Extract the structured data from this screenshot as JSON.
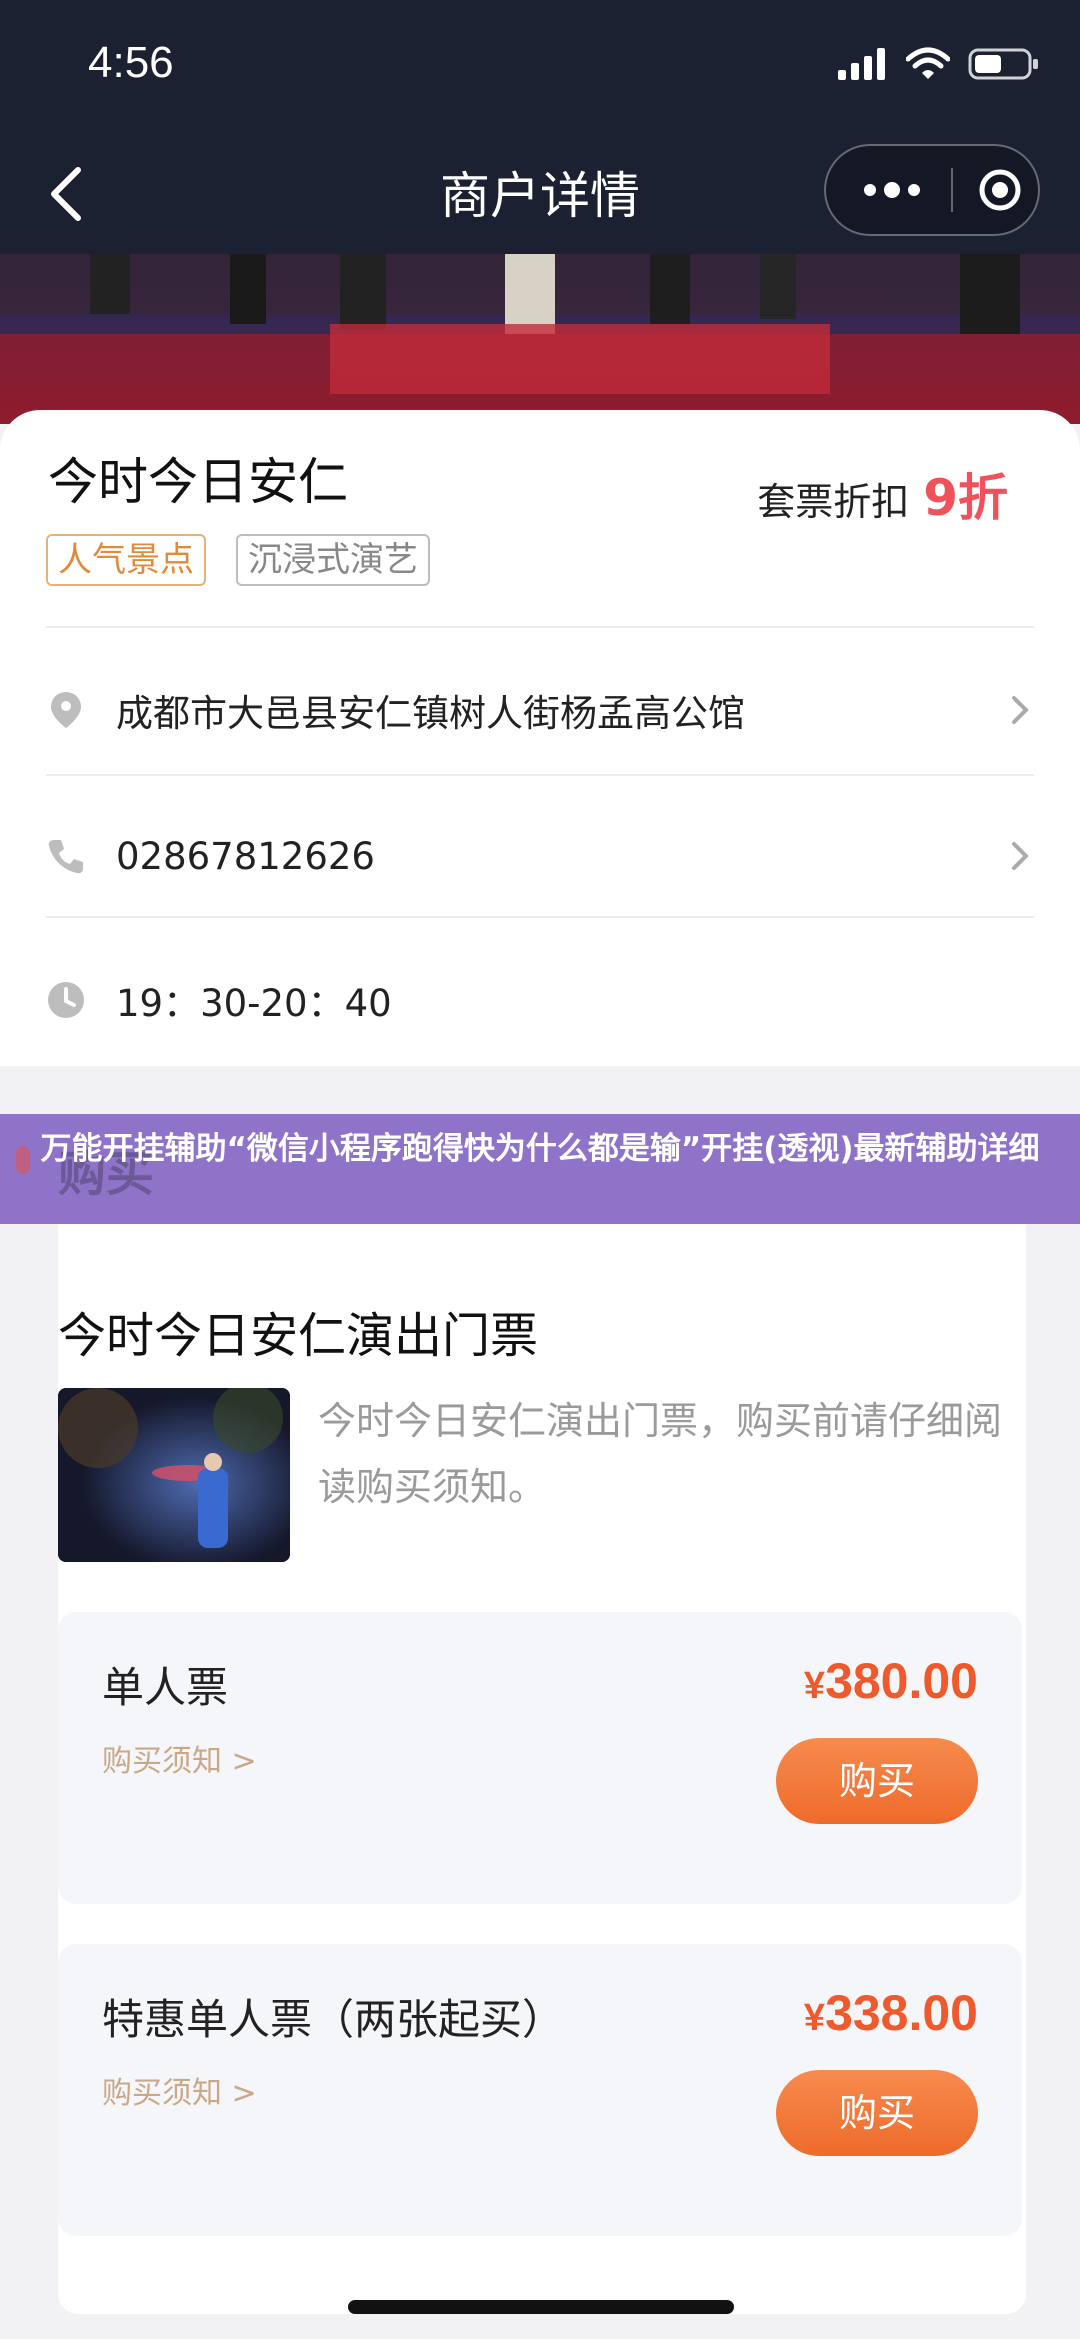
{
  "status": {
    "time": "4:56"
  },
  "nav": {
    "title": "商户详情",
    "more_icon": "more-dots-icon",
    "close_icon": "target-close-icon",
    "back_icon": "chevron-left-icon"
  },
  "merchant": {
    "name": "今时今日安仁",
    "discount_label": "套票折扣",
    "discount_value": "9折",
    "tags": [
      "人气景点",
      "沉浸式演艺"
    ],
    "address": "成都市大邑县安仁镇树人街杨孟高公馆",
    "phone": "02867812626",
    "hours": "19：30-20：40"
  },
  "banner": {
    "ghost_text": "购买",
    "text": "万能开挂辅助“微信小程序跑得快为什么都是输”开挂(透视)最新辅助详细"
  },
  "tickets_section": {
    "title": "今时今日安仁演出门票",
    "description": "今时今日安仁演出门票，购买前请仔细阅读购买须知。",
    "items": [
      {
        "name": "单人票",
        "notice": "购买须知 >",
        "currency": "¥",
        "price": "380.00",
        "buy_label": "购买"
      },
      {
        "name": "特惠单人票（两张起买）",
        "notice": "购买须知 >",
        "currency": "¥",
        "price": "338.00",
        "buy_label": "购买"
      }
    ]
  },
  "colors": {
    "accent_red": "#f0525c",
    "price_orange": "#ef5a2c",
    "banner_purple": "#8f73c9",
    "nav_dark": "#1b2130"
  }
}
